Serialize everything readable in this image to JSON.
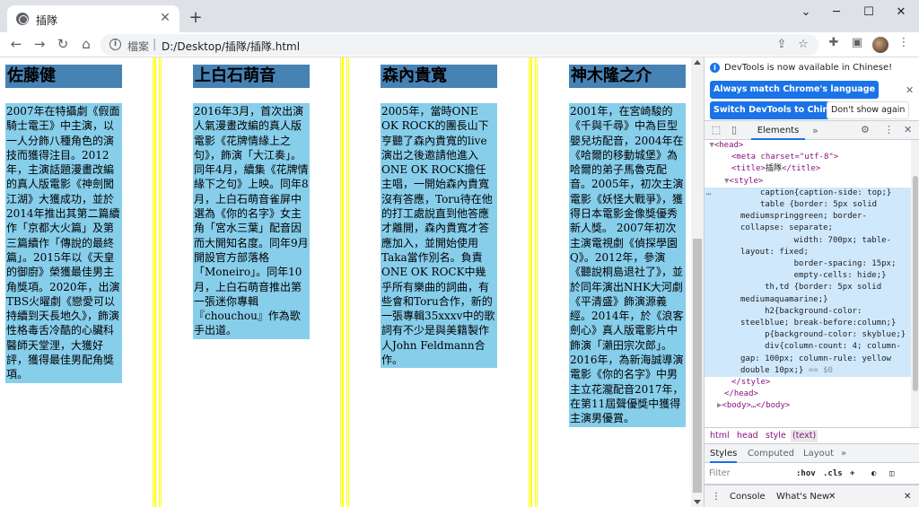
{
  "browser": {
    "tab_title": "插隊",
    "tab_close": "✕",
    "new_tab": "+",
    "window_controls": {
      "minimize": "─",
      "restore": "☐",
      "close": "✕",
      "tab_search": "⌄"
    },
    "nav": {
      "back": "←",
      "forward": "→",
      "reload": "↻",
      "home": "⌂"
    },
    "address": {
      "info_glyph": "i",
      "file_label": "檔案",
      "separator": "|",
      "url": "D:/Desktop/插隊/插隊.html"
    },
    "toolbar_icons": {
      "share": "⇪",
      "bookmark": "☆",
      "extensions": "✚",
      "sidebar": "▣",
      "menu": "⋮"
    }
  },
  "page": {
    "columns": [
      {
        "name": "佐藤健",
        "bio": "2007年在特攝劇《假面騎士電王》中主演，以一人分飾八種角色的演技而獲得注目。2012年，主演話題漫畫改編的真人版電影《神劍闖江湖》大獲成功，並於2014年推出其第二篇續作「京都大火篇」及第三篇續作「傳說的最終篇」。2015年以《天皇的御廚》榮獲最佳男主角獎項。2020年，出演TBS火曜劇《戀愛可以持續到天長地久》，飾演性格毒舌冷酷的心臟科醫師天堂浬，大獲好評，獲得最佳男配角獎項。"
      },
      {
        "name": "上白石萌音",
        "bio": "2016年3月，首次出演人氣漫畫改編的真人版電影《花牌情緣上之句》，飾演「大江奏」。同年4月，續集《花牌情緣下之句》上映。同年8月，上白石萌音雀屏中選為《你的名字》女主角「宮水三葉」配音因而大開知名度。同年9月開設官方部落格「Moneiro」。同年10月，上白石萌音推出第一張迷你專輯『chouchou』作為歌手出道。"
      },
      {
        "name": "森內貴寬",
        "bio": "2005年，當時ONE OK ROCK的團長山下亨聽了森內貴寬的live演出之後邀請他進入ONE OK ROCK擔任主唱，一開始森內貴寬沒有答應，Toru待在他的打工處說直到他答應才離開，森內貴寬才答應加入，並開始使用Taka當作別名。負責ONE OK ROCK中幾乎所有樂曲的詞曲，有些會和Toru合作，新的一張專輯35xxxv中的歌詞有不少是與美籍製作人John Feldmann合作。"
      },
      {
        "name": "神木隆之介",
        "bio": "2001年，在宮崎駿的《千與千尋》中為巨型嬰兒坊配音，2004年在《哈爾的移動城堡》為哈爾的弟子馬魯克配音。2005年，初次主演電影《妖怪大戰爭》，獲得日本電影金像獎優秀新人獎。 2007年初次主演電視劇《偵探學園Q》。2012年，參演《聽說桐島退社了》，並於同年演出NHK大河劇《平清盛》飾演源義經。2014年，於《浪客劍心》真人版電影片中飾演「瀨田宗次郎」。2016年，為新海誠導演電影《你的名字》中男主立花瀧配音2017年，在第11屆聲優獎中獲得主演男優賞。"
      }
    ]
  },
  "devtools": {
    "banner_text": "DevTools is now available in Chinese!",
    "banner_btn_match": "Always match Chrome's language",
    "banner_btn_switch": "Switch DevTools to Chinese",
    "banner_btn_dismiss": "Don't show again",
    "banner_close": "✕",
    "tab_elements": "Elements",
    "tab_more": "»",
    "settings_icon": "⚙",
    "more_icon": "⋮",
    "close_icon": "✕",
    "dom": {
      "head_open": "<head>",
      "meta": "<meta charset=\"utf-8\">",
      "title_open": "<title>",
      "title_text": "插隊",
      "title_close": "</title>",
      "style_open": "<style>",
      "css_lines": [
        "caption{caption-side: top;}",
        "table {border: 5px solid",
        "mediumspringgreen; border-",
        "collapse: separate;",
        "           width: 700px; table-",
        "layout: fixed;",
        "           border-spacing: 15px;",
        "           empty-cells: hide;}",
        "     th,td {border: 5px solid",
        "mediumaquamarine;}",
        "",
        "     h2{background-color:",
        "steelblue; break-before:column;}",
        "     p{background-color: skyblue;}",
        "     div{column-count: 4; column-",
        "gap: 100px; column-rule: yellow",
        "double 10px;}"
      ],
      "eq_sel": "== $0",
      "style_close": "</style>",
      "head_close": "</head>",
      "body_collapsed": "<body>…</body>"
    },
    "breadcrumbs": [
      "html",
      "head",
      "style",
      "(text)"
    ],
    "styles_tabs": [
      "Styles",
      "Computed",
      "Layout",
      "»"
    ],
    "filter_placeholder": "Filter",
    "filter_hov": ":hov",
    "filter_cls": ".cls",
    "filter_plus": "+",
    "drawer_console": "Console",
    "drawer_whats_new": "What's New",
    "drawer_close": "✕",
    "drawer_menu": "⋮"
  }
}
